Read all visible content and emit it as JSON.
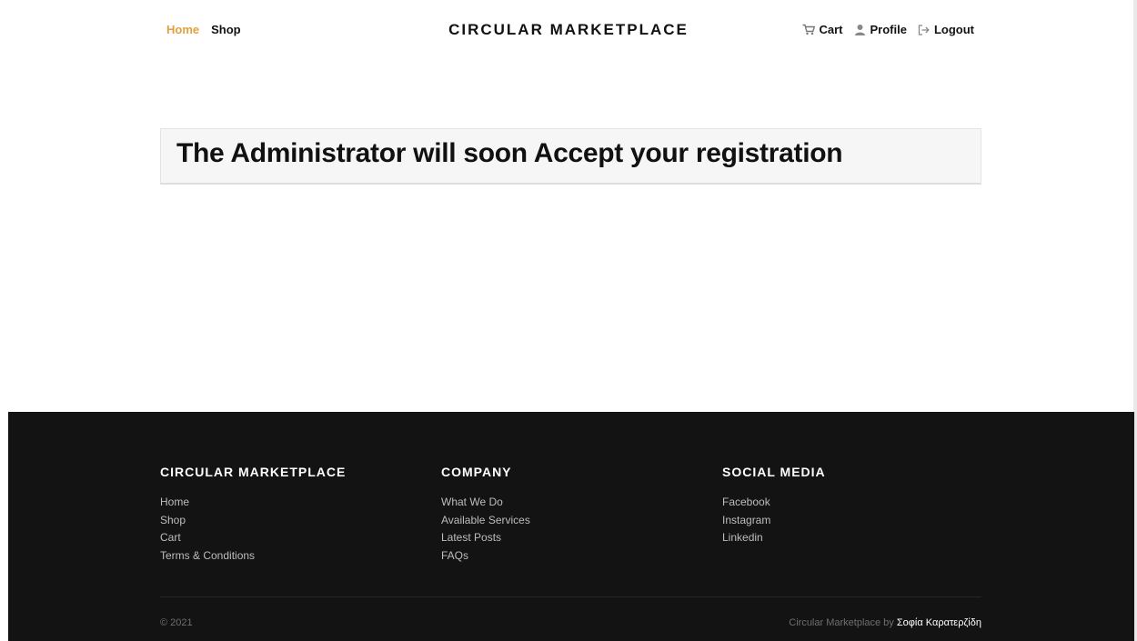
{
  "header": {
    "nav_left": [
      {
        "label": "Home",
        "active": true
      },
      {
        "label": "Shop",
        "active": false
      }
    ],
    "brand": "CIRCULAR MARKETPLACE",
    "nav_right": [
      {
        "label": "Cart",
        "icon": "cart-icon"
      },
      {
        "label": "Profile",
        "icon": "user-icon"
      },
      {
        "label": "Logout",
        "icon": "logout-icon"
      }
    ],
    "accent_color": "#e2a03f"
  },
  "main": {
    "notice_title": "The Administrator will soon Accept your registration"
  },
  "footer": {
    "columns": [
      {
        "title": "CIRCULAR MARKETPLACE",
        "links": [
          "Home",
          "Shop",
          "Cart",
          "Terms & Conditions"
        ]
      },
      {
        "title": "COMPANY",
        "links": [
          "What We Do",
          "Available Services",
          "Latest Posts",
          "FAQs"
        ]
      },
      {
        "title": "SOCIAL MEDIA",
        "links": [
          "Facebook",
          "Instagram",
          "Linkedin"
        ]
      }
    ],
    "copyright": "© 2021",
    "credit_prefix": "Circular Marketplace by ",
    "credit_author": "Σοφία Καρατερζίδη",
    "background_color": "#131313"
  }
}
